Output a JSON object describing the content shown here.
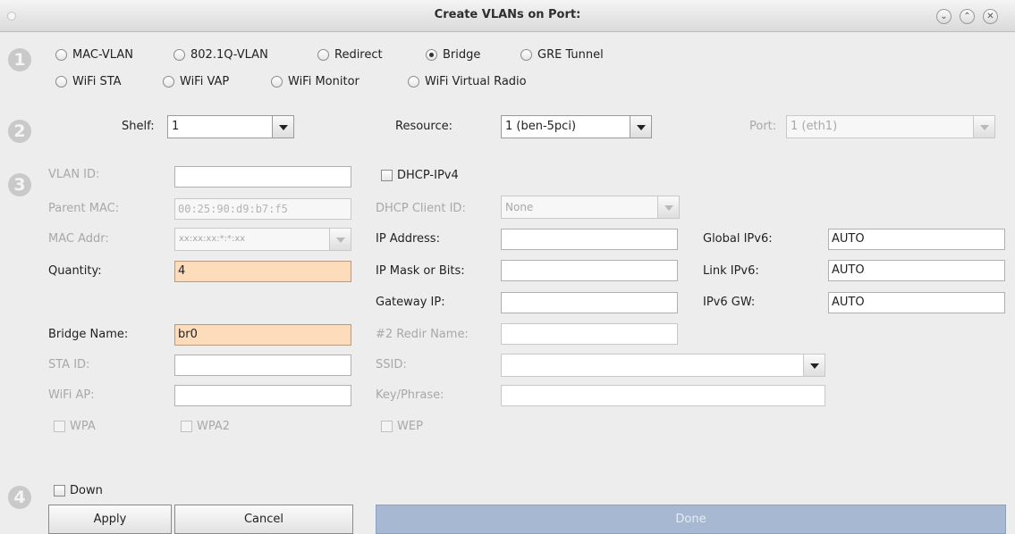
{
  "window": {
    "title": "Create VLANs on Port:"
  },
  "steps": [
    "1",
    "2",
    "3",
    "4"
  ],
  "types": {
    "mac_vlan": "MAC-VLAN",
    "dot1q_vlan": "802.1Q-VLAN",
    "redirect": "Redirect",
    "bridge": "Bridge",
    "gre_tunnel": "GRE Tunnel",
    "wifi_sta": "WiFi STA",
    "wifi_vap": "WiFi VAP",
    "wifi_monitor": "WiFi Monitor",
    "wifi_virtual_radio": "WiFi Virtual Radio",
    "selected": "Bridge"
  },
  "location": {
    "shelf_label": "Shelf:",
    "shelf_value": "1",
    "resource_label": "Resource:",
    "resource_value": "1 (ben-5pci)",
    "port_label": "Port:",
    "port_value": "1 (eth1)"
  },
  "form": {
    "vlan_id_label": "VLAN ID:",
    "vlan_id_value": "",
    "parent_mac_label": "Parent MAC:",
    "parent_mac_value": "00:25:90:d9:b7:f5",
    "mac_addr_label": "MAC Addr:",
    "mac_addr_value": "xx:xx:xx:*:*:xx",
    "quantity_label": "Quantity:",
    "quantity_value": "4",
    "bridge_name_label": "Bridge Name:",
    "bridge_name_value": "br0",
    "sta_id_label": "STA ID:",
    "sta_id_value": "",
    "wifi_ap_label": "WiFi AP:",
    "wifi_ap_value": "",
    "wpa": "WPA",
    "wpa2": "WPA2",
    "wep": "WEP",
    "dhcp_ipv4": "DHCP-IPv4",
    "dhcp_client_id_label": "DHCP Client ID:",
    "dhcp_client_id_value": "None",
    "ip_address_label": "IP Address:",
    "ip_address_value": "",
    "ip_mask_label": "IP Mask or Bits:",
    "ip_mask_value": "",
    "gateway_label": "Gateway IP:",
    "gateway_value": "",
    "redir_name_label": "#2 Redir Name:",
    "redir_name_value": "",
    "ssid_label": "SSID:",
    "ssid_value": "",
    "key_phrase_label": "Key/Phrase:",
    "key_phrase_value": "",
    "global_ipv6_label": "Global IPv6:",
    "global_ipv6_value": "AUTO",
    "link_ipv6_label": "Link IPv6:",
    "link_ipv6_value": "AUTO",
    "ipv6_gw_label": "IPv6 GW:",
    "ipv6_gw_value": "AUTO"
  },
  "footer": {
    "down_label": "Down",
    "apply_label": "Apply",
    "cancel_label": "Cancel",
    "done_label": "Done"
  },
  "colors": {
    "highlight_field": "#fddcbc",
    "done_button": "#a6b8d2"
  }
}
